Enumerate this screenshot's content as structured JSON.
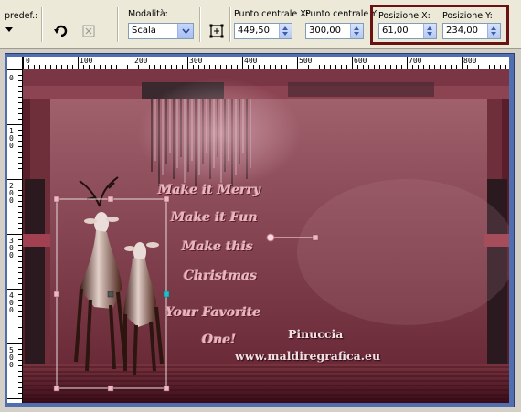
{
  "toolbar": {
    "preset_label": "predef.:",
    "mode_label": "Modalità:",
    "mode_value": "Scala",
    "center_x_label": "Punto centrale X:",
    "center_x_value": "449,50",
    "center_y_label": "Punto centrale Y:",
    "center_y_value": "300,00",
    "pos_x_label": "Posizione X:",
    "pos_x_value": "61,00",
    "pos_y_label": "Posizione Y:",
    "pos_y_value": "234,00",
    "icons": [
      "preset-dropdown-icon",
      "reset-icon",
      "delete-icon",
      "center-pivot-icon"
    ],
    "highlight_color": "#6a1212"
  },
  "ruler_h": [
    "0",
    "100",
    "200",
    "300",
    "400",
    "500",
    "600",
    "700",
    "800"
  ],
  "ruler_v": [
    "0",
    "100",
    "200",
    "300",
    "400",
    "500"
  ],
  "canvas": {
    "poem_lines": [
      "Make it Merry",
      "Make it Fun",
      "Make this",
      "Christmas",
      "Your Favorite",
      "One!"
    ],
    "signature": "Pinuccia",
    "website": "www.maldiregrafica.eu",
    "background_color": "#6e3340",
    "handle_color": "#e8a0b0"
  }
}
